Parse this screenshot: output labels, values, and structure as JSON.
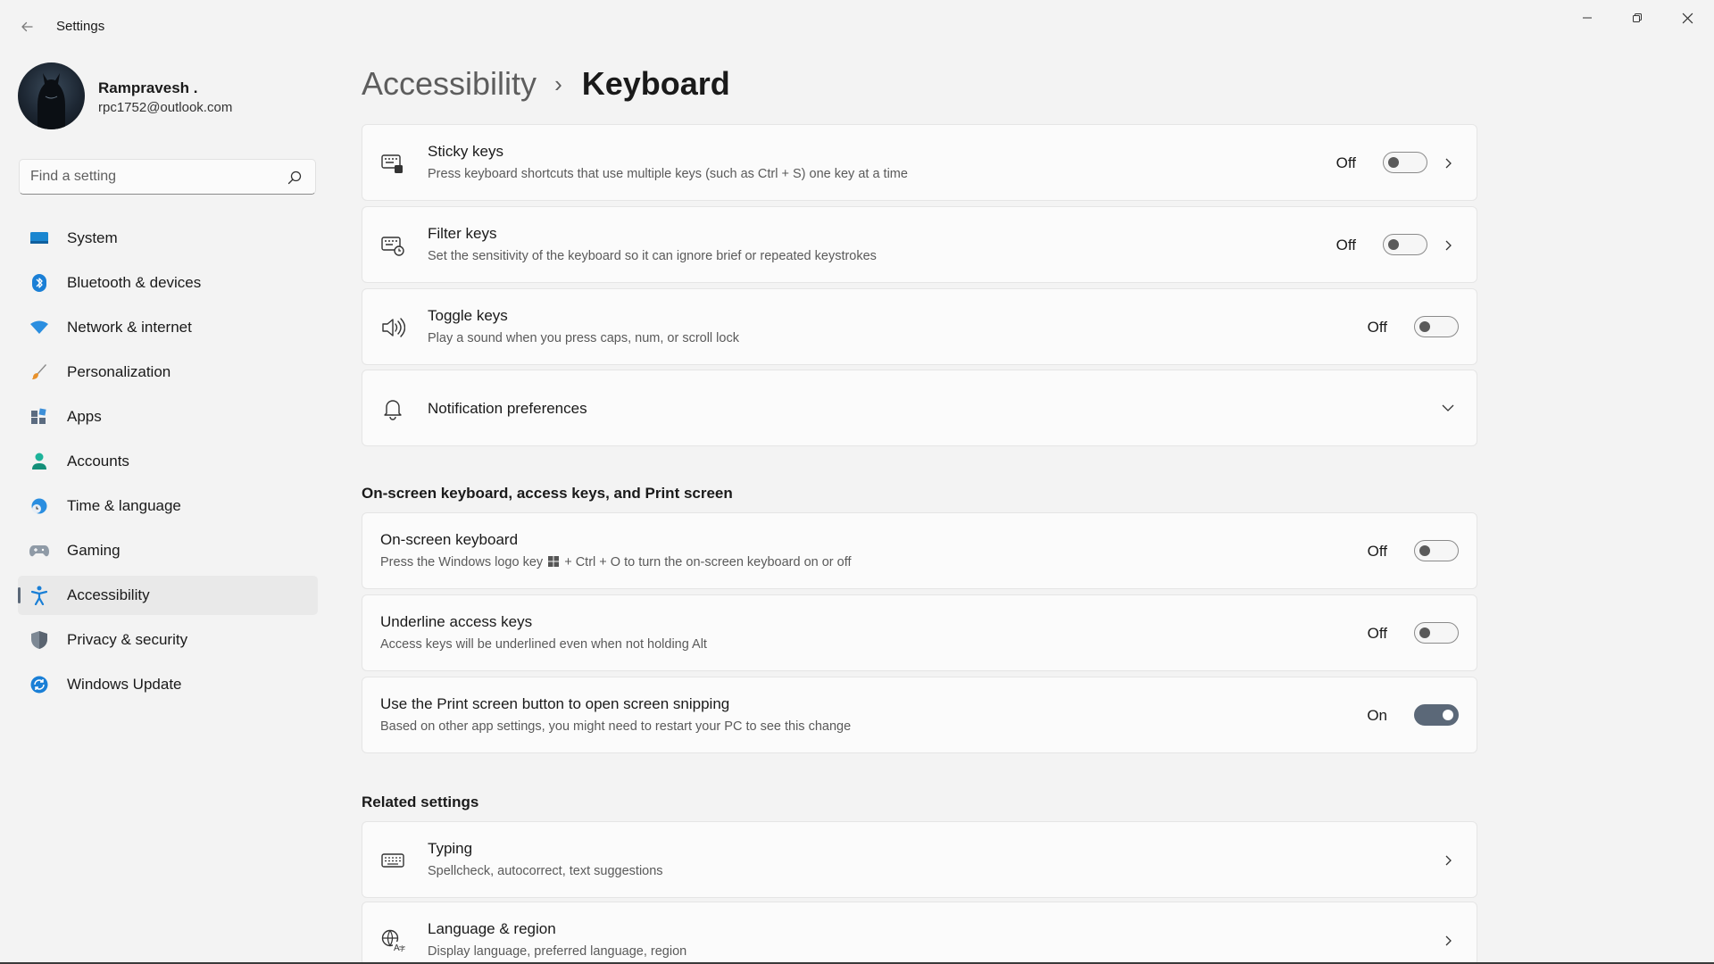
{
  "window": {
    "title": "Settings",
    "back_icon": "back-arrow-icon",
    "minimize_icon": "minimize-icon",
    "restore_icon": "restore-icon",
    "close_icon": "close-icon"
  },
  "profile": {
    "name": "Rampravesh .",
    "email": "rpc1752@outlook.com"
  },
  "search": {
    "placeholder": "Find a setting",
    "value": ""
  },
  "sidebar": {
    "items": [
      {
        "label": "System",
        "icon": "system-icon",
        "active": false
      },
      {
        "label": "Bluetooth & devices",
        "icon": "bluetooth-icon",
        "active": false
      },
      {
        "label": "Network & internet",
        "icon": "wifi-icon",
        "active": false
      },
      {
        "label": "Personalization",
        "icon": "brush-icon",
        "active": false
      },
      {
        "label": "Apps",
        "icon": "apps-icon",
        "active": false
      },
      {
        "label": "Accounts",
        "icon": "person-icon",
        "active": false
      },
      {
        "label": "Time & language",
        "icon": "globe-clock-icon",
        "active": false
      },
      {
        "label": "Gaming",
        "icon": "gamepad-icon",
        "active": false
      },
      {
        "label": "Accessibility",
        "icon": "accessibility-icon",
        "active": true
      },
      {
        "label": "Privacy & security",
        "icon": "shield-icon",
        "active": false
      },
      {
        "label": "Windows Update",
        "icon": "update-icon",
        "active": false
      }
    ]
  },
  "breadcrumb": {
    "parent": "Accessibility",
    "separator": "›",
    "current": "Keyboard"
  },
  "cards": {
    "sticky": {
      "title": "Sticky keys",
      "desc": "Press keyboard shortcuts that use multiple keys (such as Ctrl + S) one key at a time",
      "state": "Off",
      "on": false
    },
    "filter": {
      "title": "Filter keys",
      "desc": "Set the sensitivity of the keyboard so it can ignore brief or repeated keystrokes",
      "state": "Off",
      "on": false
    },
    "toggle": {
      "title": "Toggle keys",
      "desc": "Play a sound when you press caps, num, or scroll lock",
      "state": "Off",
      "on": false
    },
    "notification": {
      "title": "Notification preferences"
    }
  },
  "onscreen_section": {
    "heading": "On-screen keyboard, access keys, and Print screen",
    "osk": {
      "title": "On-screen keyboard",
      "desc_before": "Press the Windows logo key",
      "desc_after": "+ Ctrl + O to turn the on-screen keyboard on or off",
      "state": "Off",
      "on": false
    },
    "underline": {
      "title": "Underline access keys",
      "desc": "Access keys will be underlined even when not holding Alt",
      "state": "Off",
      "on": false
    },
    "printscreen": {
      "title": "Use the Print screen button to open screen snipping",
      "desc": "Based on other app settings, you might need to restart your PC to see this change",
      "state": "On",
      "on": true
    }
  },
  "related": {
    "heading": "Related settings",
    "typing": {
      "title": "Typing",
      "desc": "Spellcheck, autocorrect, text suggestions"
    },
    "language": {
      "title": "Language & region",
      "desc": "Display language, preferred language, region"
    }
  },
  "colors": {
    "accent": "#5b6878",
    "background": "#f3f3f3",
    "card": "#fbfbfb"
  }
}
